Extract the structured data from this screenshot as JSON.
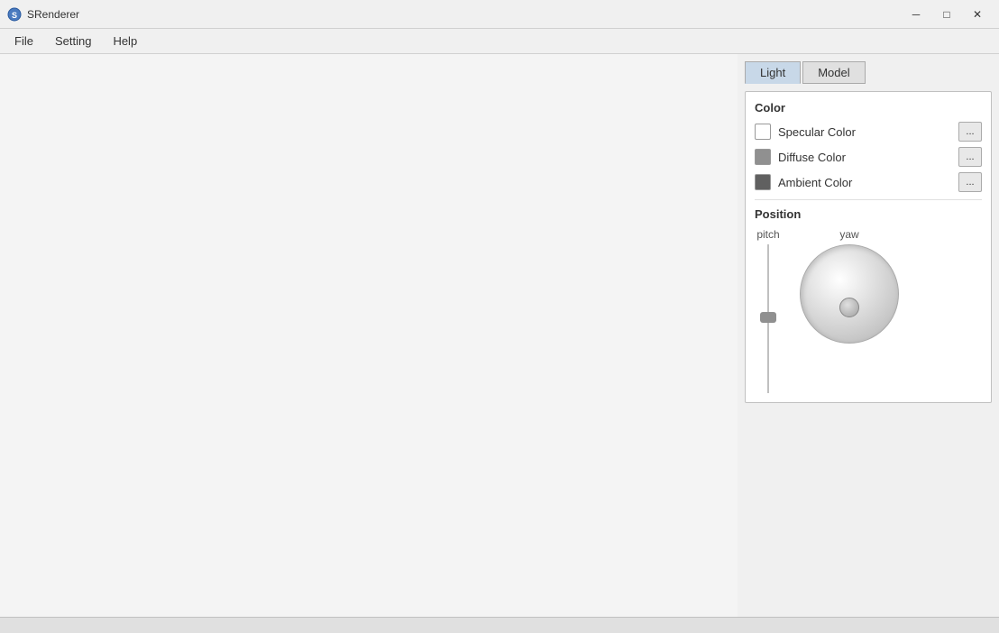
{
  "titleBar": {
    "icon": "S",
    "title": "SRenderer",
    "minimizeLabel": "─",
    "restoreLabel": "□",
    "closeLabel": "✕"
  },
  "menuBar": {
    "items": [
      "File",
      "Setting",
      "Help"
    ]
  },
  "rightPanel": {
    "tabs": [
      {
        "id": "light",
        "label": "Light",
        "active": true
      },
      {
        "id": "model",
        "label": "Model",
        "active": false
      }
    ],
    "colorSection": {
      "title": "Color",
      "rows": [
        {
          "id": "specular",
          "label": "Specular Color",
          "swatchColor": "#ffffff",
          "menuLabel": "..."
        },
        {
          "id": "diffuse",
          "label": "Diffuse Color",
          "swatchColor": "#909090",
          "menuLabel": "..."
        },
        {
          "id": "ambient",
          "label": "Ambient Color",
          "swatchColor": "#606060",
          "menuLabel": "..."
        }
      ]
    },
    "positionSection": {
      "title": "Position",
      "pitchLabel": "pitch",
      "yawLabel": "yaw"
    }
  }
}
